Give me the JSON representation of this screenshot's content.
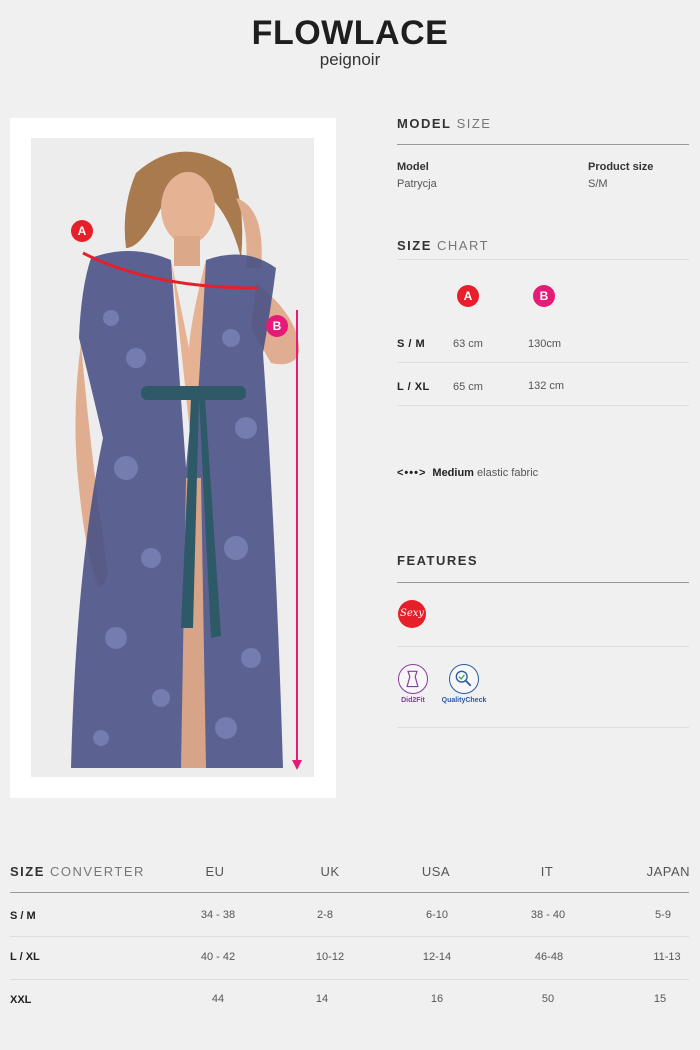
{
  "header": {
    "title": "FLOWLACE",
    "subtitle": "peignoir"
  },
  "photo": {
    "marker_a": "A",
    "marker_b": "B"
  },
  "model_size": {
    "heading_bold": "MODEL",
    "heading_light": "SIZE",
    "model_label": "Model",
    "model_value": "Patrycja",
    "product_size_label": "Product size",
    "product_size_value": "S/M"
  },
  "size_chart": {
    "heading_bold": "SIZE",
    "heading_light": "CHART",
    "col_a": "A",
    "col_b": "B",
    "rows": [
      {
        "size": "S / M",
        "a": "63 cm",
        "b": "130cm"
      },
      {
        "size": "L / XL",
        "a": "65 cm",
        "b": "132 cm"
      }
    ]
  },
  "fabric": {
    "dots": "<•••>",
    "strength": "Medium",
    "text": "elastic fabric"
  },
  "features": {
    "heading": "FEATURES",
    "sexy_badge": "Sexy",
    "did2fit": "Did2Fit",
    "quality": "QualityCheck"
  },
  "converter": {
    "heading_bold": "SIZE",
    "heading_light": "CONVERTER",
    "columns": [
      "EU",
      "UK",
      "USA",
      "IT",
      "JAPAN"
    ],
    "rows": [
      {
        "size": "S / M",
        "values": [
          "34 - 38",
          "2-8",
          "6-10",
          "38 - 40",
          "5-9"
        ]
      },
      {
        "size": "L / XL",
        "values": [
          "40 - 42",
          "10-12",
          "12-14",
          "46-48",
          "11-13"
        ]
      },
      {
        "size": "XXL",
        "values": [
          "44",
          "14",
          "16",
          "50",
          "15"
        ]
      }
    ]
  },
  "colors": {
    "marker_red": "#e5202a",
    "marker_pink": "#e71a77",
    "lace": "#4a5286"
  }
}
